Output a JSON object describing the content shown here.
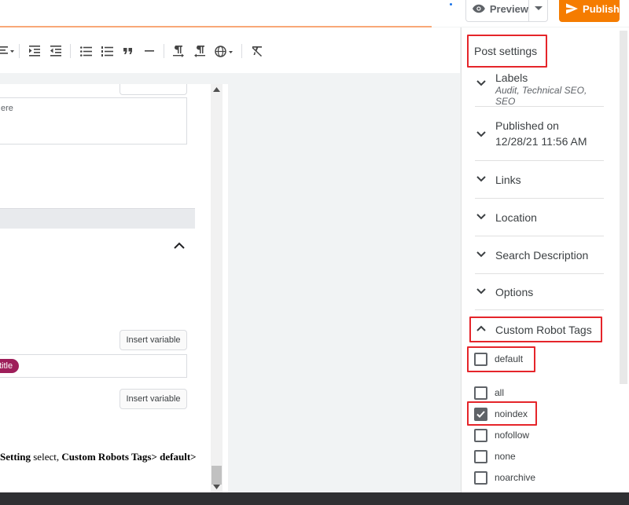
{
  "header": {
    "preview_label": "Preview",
    "publish_label": "Publish",
    "accent_color": "#f57c00"
  },
  "toolbar": {
    "icons": [
      "align-icon",
      "indent-increase-icon",
      "indent-decrease-icon",
      "bulleted-list-icon",
      "numbered-list-icon",
      "quote-icon",
      "horizontal-rule-icon",
      "ltr-icon",
      "rtl-icon",
      "language-icon",
      "clear-formatting-icon"
    ]
  },
  "editor": {
    "textarea_text": "ere",
    "insert_variable_label": "Insert variable",
    "chip_text": "title",
    "instruction_parts": [
      "Setting",
      " select, ",
      "Custom Robots Tags> default>"
    ]
  },
  "settings": {
    "title": "Post settings",
    "labels": {
      "title": "Labels",
      "value": "Audit, Technical SEO, SEO"
    },
    "published": {
      "title": "Published on",
      "value": "12/28/21 11:56 AM"
    },
    "links": "Links",
    "location": "Location",
    "search_description": "Search Description",
    "options": "Options",
    "custom_robot_tags": "Custom Robot Tags",
    "robot_tags": [
      {
        "label": "default",
        "checked": false
      },
      {
        "label": "all",
        "checked": false
      },
      {
        "label": "noindex",
        "checked": true
      },
      {
        "label": "nofollow",
        "checked": false
      },
      {
        "label": "none",
        "checked": false
      },
      {
        "label": "noarchive",
        "checked": false
      }
    ],
    "highlight_color": "#e5252a"
  }
}
